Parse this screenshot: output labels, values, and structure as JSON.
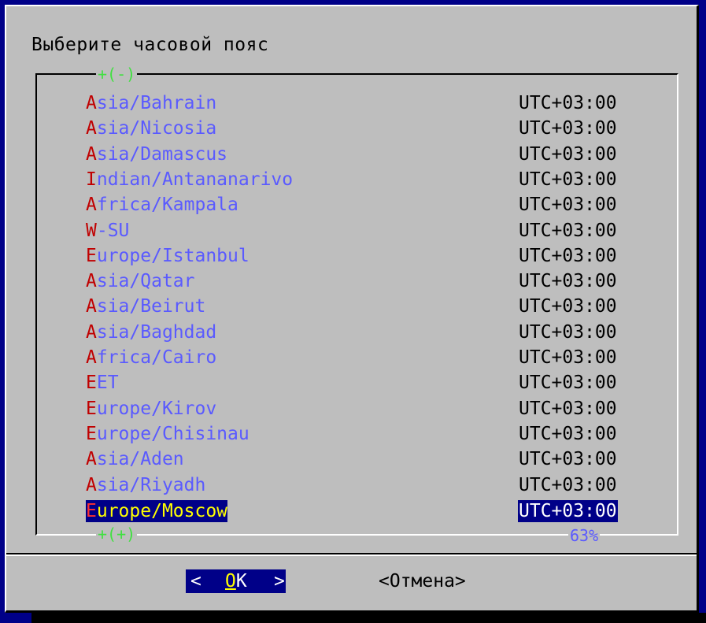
{
  "dialog": {
    "title": "Выберите часовой пояс"
  },
  "scroll": {
    "up_indicator": "+(-)",
    "down_indicator": "+(+)",
    "percent": "63%"
  },
  "timezones": [
    {
      "first": "A",
      "rest": "sia/Bahrain",
      "offset": "UTC+03:00"
    },
    {
      "first": "A",
      "rest": "sia/Nicosia",
      "offset": "UTC+03:00"
    },
    {
      "first": "A",
      "rest": "sia/Damascus",
      "offset": "UTC+03:00"
    },
    {
      "first": "I",
      "rest": "ndian/Antananarivo",
      "offset": "UTC+03:00"
    },
    {
      "first": "A",
      "rest": "frica/Kampala",
      "offset": "UTC+03:00"
    },
    {
      "first": "W",
      "rest": "-SU",
      "offset": "UTC+03:00"
    },
    {
      "first": "E",
      "rest": "urope/Istanbul",
      "offset": "UTC+03:00"
    },
    {
      "first": "A",
      "rest": "sia/Qatar",
      "offset": "UTC+03:00"
    },
    {
      "first": "A",
      "rest": "sia/Beirut",
      "offset": "UTC+03:00"
    },
    {
      "first": "A",
      "rest": "sia/Baghdad",
      "offset": "UTC+03:00"
    },
    {
      "first": "A",
      "rest": "frica/Cairo",
      "offset": "UTC+03:00"
    },
    {
      "first": "E",
      "rest": "ET",
      "offset": "UTC+03:00"
    },
    {
      "first": "E",
      "rest": "urope/Kirov",
      "offset": "UTC+03:00"
    },
    {
      "first": "E",
      "rest": "urope/Chisinau",
      "offset": "UTC+03:00"
    },
    {
      "first": "A",
      "rest": "sia/Aden",
      "offset": "UTC+03:00"
    },
    {
      "first": "A",
      "rest": "sia/Riyadh",
      "offset": "UTC+03:00"
    },
    {
      "first": "E",
      "rest": "urope/Moscow",
      "offset": "UTC+03:00",
      "selected": true
    }
  ],
  "buttons": {
    "ok_left": "<",
    "ok_hotkey": "О",
    "ok_rest": "K",
    "ok_right": ">",
    "cancel": "<Отмена>"
  },
  "colors": {
    "background": "#000088",
    "dialog": "#bebebe",
    "item_text": "#5a5aff",
    "hotkey": "#c00000",
    "selected_bg": "#000088",
    "selected_text": "#ffff00",
    "scroll_indicator": "#40e040"
  }
}
